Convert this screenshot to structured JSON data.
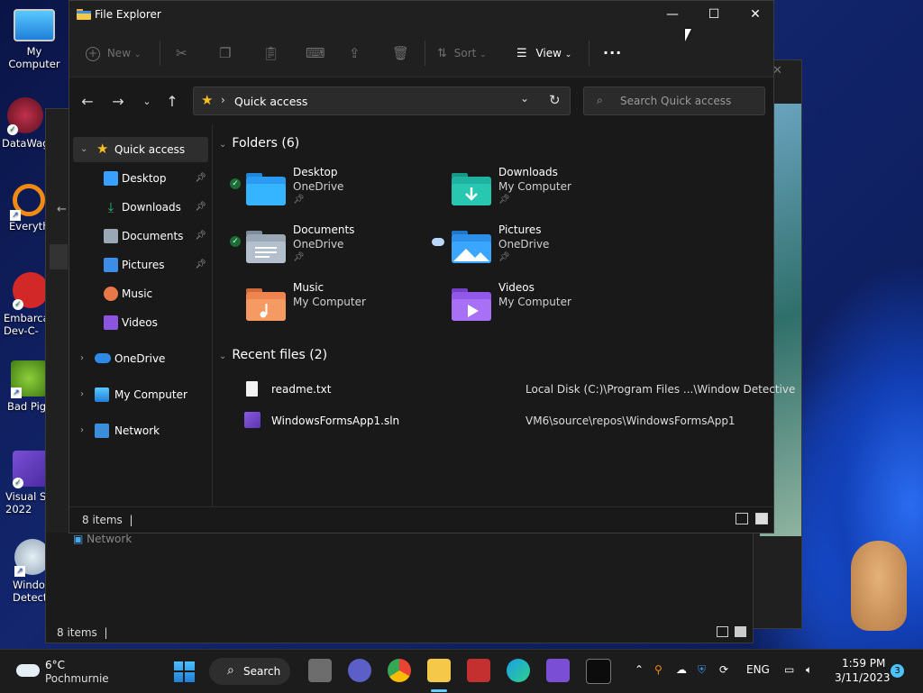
{
  "desktop": {
    "icons": [
      {
        "label": "My Computer"
      },
      {
        "label": "DataWag"
      },
      {
        "label": "Everyth"
      },
      {
        "label": "Embarca\nDev-C-"
      },
      {
        "label": "Bad Pig"
      },
      {
        "label": "Visual St\n2022"
      },
      {
        "label": "Windo\nDetect"
      }
    ]
  },
  "background_window": {
    "sidebar_item": "Network",
    "status": "8 items"
  },
  "window": {
    "title": "File Explorer",
    "controls": {
      "minimize": "—",
      "maximize": "☐",
      "close": "✕"
    },
    "toolbar": {
      "new_label": "New",
      "sort_label": "Sort",
      "view_label": "View",
      "more_label": "···"
    },
    "address": {
      "location": "Quick access"
    },
    "search": {
      "placeholder": "Search Quick access"
    },
    "sidebar": {
      "quick_access": "Quick access",
      "pinned": [
        {
          "label": "Desktop",
          "color": "#3aa0ff"
        },
        {
          "label": "Downloads",
          "color": "#2bb673"
        },
        {
          "label": "Documents",
          "color": "#9aa7b5"
        },
        {
          "label": "Pictures",
          "color": "#3b8de6"
        },
        {
          "label": "Music",
          "color": "#e8784a"
        },
        {
          "label": "Videos",
          "color": "#8b55e0"
        }
      ],
      "onedrive": "OneDrive",
      "my_computer": "My Computer",
      "network": "Network"
    },
    "folders_header": "Folders (6)",
    "folders": [
      {
        "name": "Desktop",
        "location": "OneDrive",
        "color": "#2b9af3"
      },
      {
        "name": "Downloads",
        "location": "My Computer",
        "color": "#20b2a0"
      },
      {
        "name": "Documents",
        "location": "OneDrive",
        "color": "#9aa7b5"
      },
      {
        "name": "Pictures",
        "location": "OneDrive",
        "color": "#2c8fe8"
      },
      {
        "name": "Music",
        "location": "My Computer",
        "color": "#ee8450"
      },
      {
        "name": "Videos",
        "location": "My Computer",
        "color": "#9258e8"
      }
    ],
    "recent_header": "Recent files (2)",
    "recent": [
      {
        "name": "readme.txt",
        "path": "Local Disk (C:)\\Program Files ...\\Window Detective"
      },
      {
        "name": "WindowsFormsApp1.sln",
        "path": "VM6\\source\\repos\\WindowsFormsApp1"
      }
    ],
    "status": "8 items"
  },
  "taskbar": {
    "weather_temp": "6°C",
    "weather_desc": "Pochmurnie",
    "search_label": "Search",
    "language": "ENG",
    "time": "1:59 PM",
    "date": "3/11/2023",
    "notifications": "3"
  }
}
